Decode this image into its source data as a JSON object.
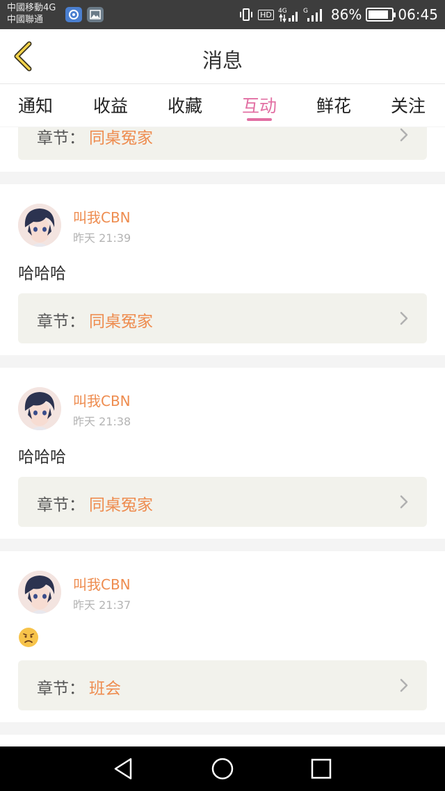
{
  "status_bar": {
    "carrier_1": "中國移動4G",
    "carrier_2": "中國聯通",
    "network_hd": "HD",
    "network_4g": "4G",
    "network_g": "G",
    "battery_level": 0.86,
    "battery_percent": "86%",
    "time": "06:45"
  },
  "header": {
    "title": "消息"
  },
  "tabs": [
    {
      "label": "通知",
      "active": false
    },
    {
      "label": "收益",
      "active": false
    },
    {
      "label": "收藏",
      "active": false
    },
    {
      "label": "互动",
      "active": true
    },
    {
      "label": "鲜花",
      "active": false
    },
    {
      "label": "关注",
      "active": false
    }
  ],
  "colors": {
    "accent": "#e26fa3",
    "username": "#ee8c4f",
    "chapter_bg": "#f2f2ec"
  },
  "messages": [
    {
      "chapter_label": "章节：",
      "chapter_name": "同桌冤家"
    },
    {
      "username": "叫我CBN",
      "time": "昨天 21:39",
      "comment": "哈哈哈",
      "chapter_label": "章节：",
      "chapter_name": "同桌冤家"
    },
    {
      "username": "叫我CBN",
      "time": "昨天 21:38",
      "comment": "哈哈哈",
      "chapter_label": "章节：",
      "chapter_name": "同桌冤家"
    },
    {
      "username": "叫我CBN",
      "time": "昨天 21:37",
      "comment_icon": "frowning-face-emoji",
      "chapter_label": "章节：",
      "chapter_name": "班会"
    }
  ],
  "nav_bar": {
    "back_icon": "triangle-back-icon",
    "home_icon": "circle-home-icon",
    "recents_icon": "square-recents-icon"
  }
}
